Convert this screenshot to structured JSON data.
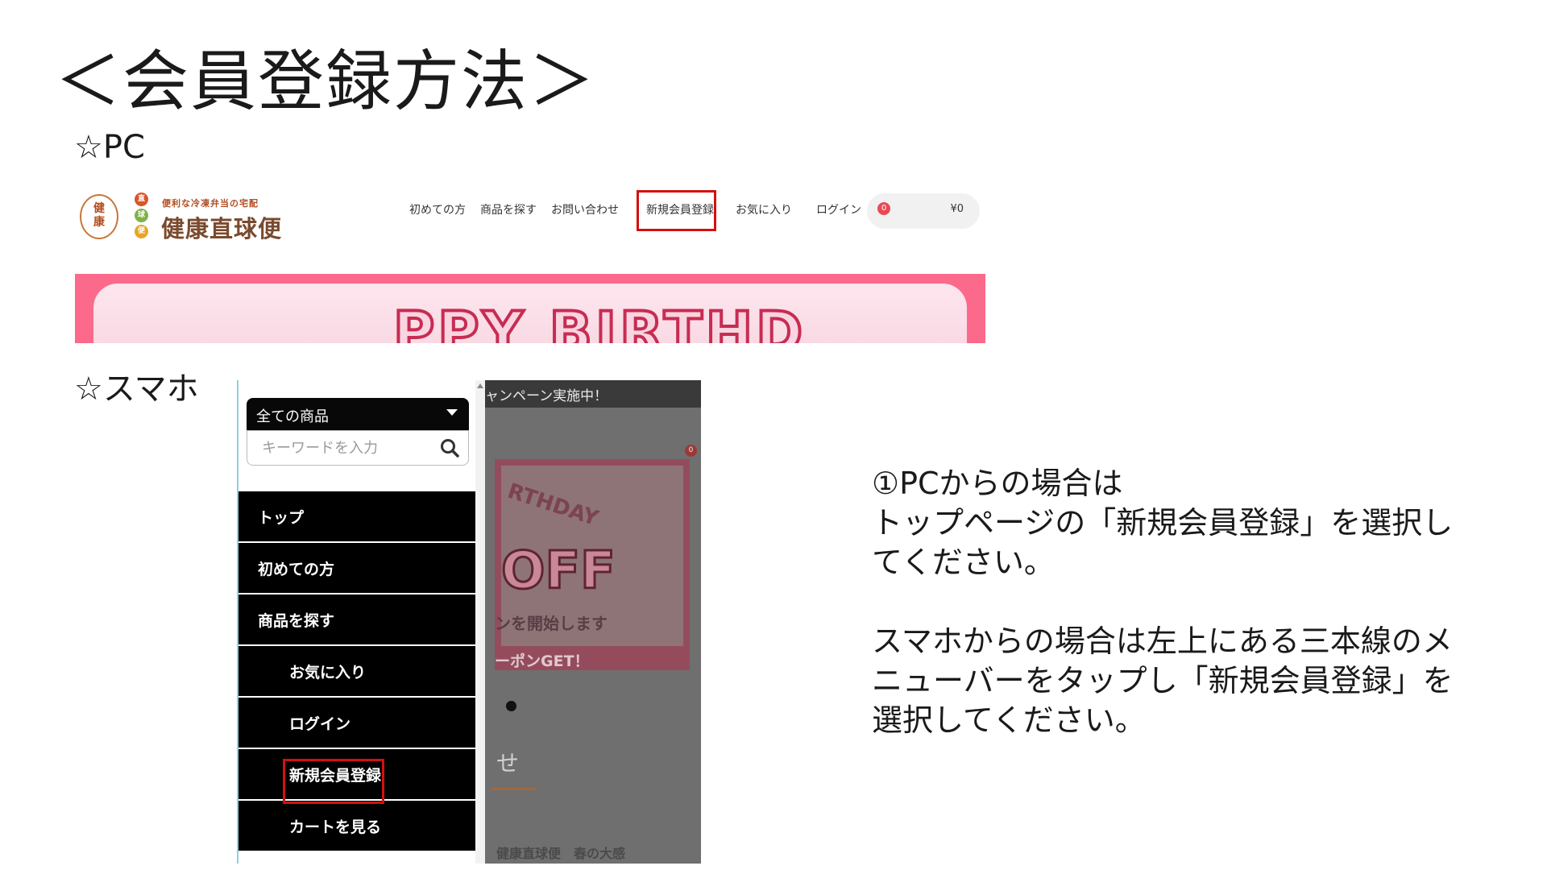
{
  "slide": {
    "title": "＜会員登録方法＞",
    "pc_label": "☆PC",
    "sp_label": "☆スマホ"
  },
  "pc_screenshot": {
    "logo": {
      "circle_text": "健康",
      "dots": [
        "直",
        "球",
        "便"
      ],
      "tagline": "便利な冷凍弁当の宅配",
      "name": "健康直球便"
    },
    "nav": [
      "初めての方",
      "商品を探す",
      "お問い合わせ",
      "新規会員登録",
      "お気に入り",
      "ログイン"
    ],
    "cart": {
      "badge": "0",
      "total": "¥0"
    },
    "banner_text": "PPY  BIRTHD",
    "highlight_color": "#d41010",
    "banner_color": "#fb6a8a"
  },
  "sp_screenshot": {
    "campaign": "ャンペーン実施中！",
    "cart_badge": "0",
    "category": "全ての商品",
    "search_placeholder": "キーワードを入力",
    "menu": [
      {
        "label": "トップ"
      },
      {
        "label": "初めての方"
      },
      {
        "label": "商品を探す"
      },
      {
        "label": "お気に入り"
      },
      {
        "label": "ログイン"
      },
      {
        "label": "新規会員登録"
      },
      {
        "label": "カートを見る"
      }
    ],
    "banner": {
      "line1": "RTHDAY",
      "line2": "OFF",
      "line3": "ンを開始します",
      "line4": "ーポンGET！"
    },
    "section_partial": "せ",
    "footer_text": "健康直球便　春の大感"
  },
  "instructions": {
    "pc": [
      "①PCからの場合は",
      "トップページの「新規会員登録」を選択し",
      "てください。"
    ],
    "sp": [
      "スマホからの場合は左上にある三本線のメ",
      "ニューバーをタップし「新規会員登録」を",
      "選択してください。"
    ]
  }
}
